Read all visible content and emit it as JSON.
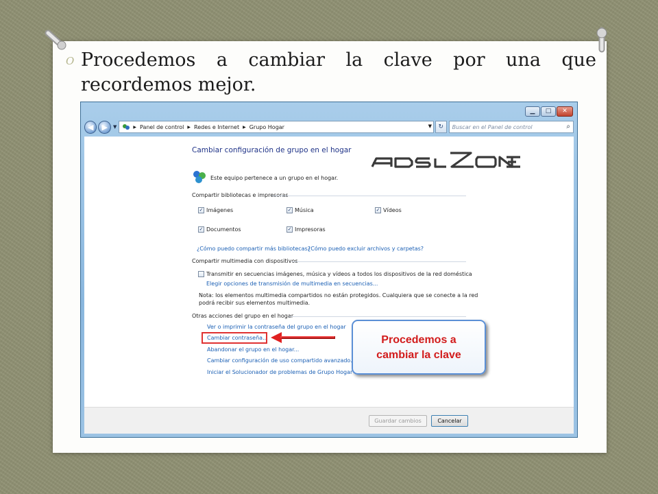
{
  "slide": {
    "title_line1": "Procedemos a cambiar la clave por una que",
    "title_line2": "recordemos mejor."
  },
  "window": {
    "breadcrumb": [
      "Panel de control",
      "Redes e Internet",
      "Grupo Hogar"
    ],
    "search_placeholder": "Buscar en el Panel de control"
  },
  "page": {
    "heading": "Cambiar configuración de grupo en el hogar",
    "membership_text": "Este equipo pertenece a un grupo en el hogar.",
    "share_section": "Compartir bibliotecas e impresoras",
    "libraries": [
      {
        "label": "Imágenes",
        "checked": true
      },
      {
        "label": "Música",
        "checked": true
      },
      {
        "label": "Vídeos",
        "checked": true
      },
      {
        "label": "Documentos",
        "checked": true
      },
      {
        "label": "Impresoras",
        "checked": true
      }
    ],
    "help_link_1": "¿Cómo puedo compartir más bibliotecas?",
    "help_link_2": "¿Cómo puedo excluir archivos y carpetas?",
    "media_section": "Compartir multimedia con dispositivos",
    "stream_checkbox": "Transmitir en secuencias imágenes, música y vídeos a todos los dispositivos de la red doméstica",
    "stream_checked": false,
    "stream_options_link": "Elegir opciones de transmisión de multimedia en secuencias...",
    "note_line1": "Nota: los elementos multimedia compartidos no están protegidos. Cualquiera que se conecte a la red",
    "note_line2": "podrá recibir sus elementos multimedia.",
    "other_section": "Otras acciones del grupo en el hogar",
    "actions": [
      "Ver o imprimir la contraseña del grupo en el hogar",
      "Cambiar contraseña...",
      "Abandonar el grupo en el hogar...",
      "Cambiar configuración de uso compartido avanzado...",
      "Iniciar el Solucionador de problemas de Grupo Hogar"
    ],
    "save_button": "Guardar cambios",
    "cancel_button": "Cancelar"
  },
  "annotation": {
    "callout_line1": "Procedemos a",
    "callout_line2": "cambiar la clave",
    "color": "#d21c1c"
  },
  "logo_text": "ADSLZONE"
}
